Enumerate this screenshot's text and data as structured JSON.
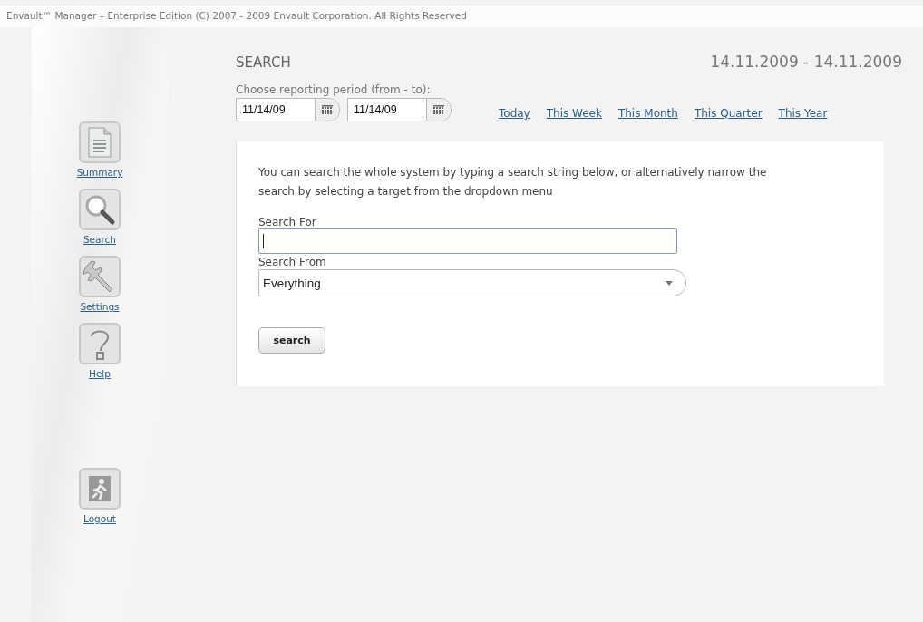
{
  "header": {
    "copyright": "Envault™ Manager – Enterprise Edition (C) 2007 - 2009 Envault Corporation. All Rights Reserved"
  },
  "sidebar": {
    "items": [
      {
        "label": "Summary",
        "kind": "document"
      },
      {
        "label": "Search",
        "kind": "magnifier"
      },
      {
        "label": "Settings",
        "kind": "wrench"
      },
      {
        "label": "Help",
        "kind": "question"
      },
      {
        "label": "Logout",
        "kind": "exit"
      }
    ]
  },
  "page": {
    "title": "SEARCH",
    "date_range": "14.11.2009 - 14.11.2009"
  },
  "period": {
    "label": "Choose reporting period (from - to):",
    "from": "11/14/09",
    "to": "11/14/09",
    "shortcuts": [
      "Today",
      "This Week",
      "This Month",
      "This Quarter",
      "This Year"
    ]
  },
  "search_panel": {
    "intro": "You can search the whole system by typing a search string below, or alternatively narrow the search by selecting a target from the dropdown menu",
    "search_for_label": "Search For",
    "search_from_label": "Search From",
    "search_from_value": "Everything",
    "button": "search"
  }
}
